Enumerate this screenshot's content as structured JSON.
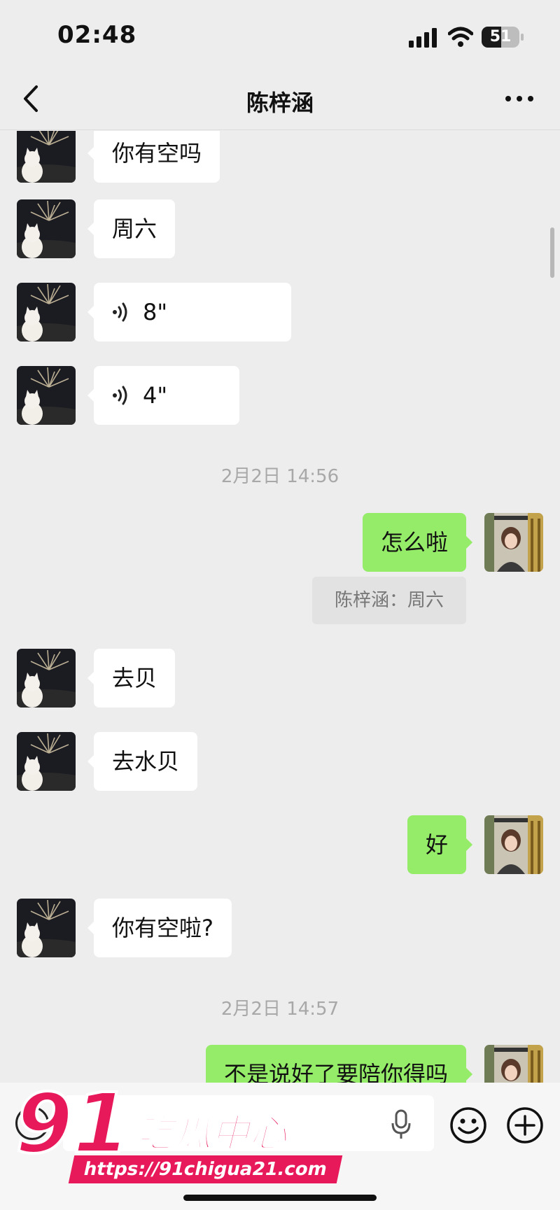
{
  "status_bar": {
    "time": "02:48",
    "battery_level": "51",
    "battery_fraction": 0.51
  },
  "header": {
    "title": "陈梓涵"
  },
  "messages": [
    {
      "side": "left",
      "type": "text",
      "text": "你有空吗"
    },
    {
      "side": "left",
      "type": "text",
      "text": "周六"
    },
    {
      "side": "left",
      "type": "voice",
      "duration": "8\""
    },
    {
      "side": "left",
      "type": "voice",
      "duration": "4\""
    },
    {
      "type": "timestamp",
      "text": "2月2日 14:56"
    },
    {
      "side": "right",
      "type": "text",
      "text": "怎么啦"
    },
    {
      "type": "quote",
      "text": "陈梓涵：周六"
    },
    {
      "side": "left",
      "type": "text",
      "text": "去贝"
    },
    {
      "side": "left",
      "type": "text",
      "text": "去水贝"
    },
    {
      "side": "right",
      "type": "text",
      "text": "好"
    },
    {
      "side": "left",
      "type": "text",
      "text": "你有空啦?"
    },
    {
      "type": "timestamp",
      "text": "2月2日 14:57"
    },
    {
      "side": "right",
      "type": "text",
      "text": "不是说好了要陪你得吗"
    }
  ],
  "watermark": {
    "brand_number": "91",
    "brand_name": "吃瓜中心",
    "url": "https://91chigua21.com"
  },
  "colors": {
    "sent_bubble": "#95ec69",
    "received_bubble": "#ffffff",
    "background": "#ededed",
    "watermark": "#e8195a"
  }
}
